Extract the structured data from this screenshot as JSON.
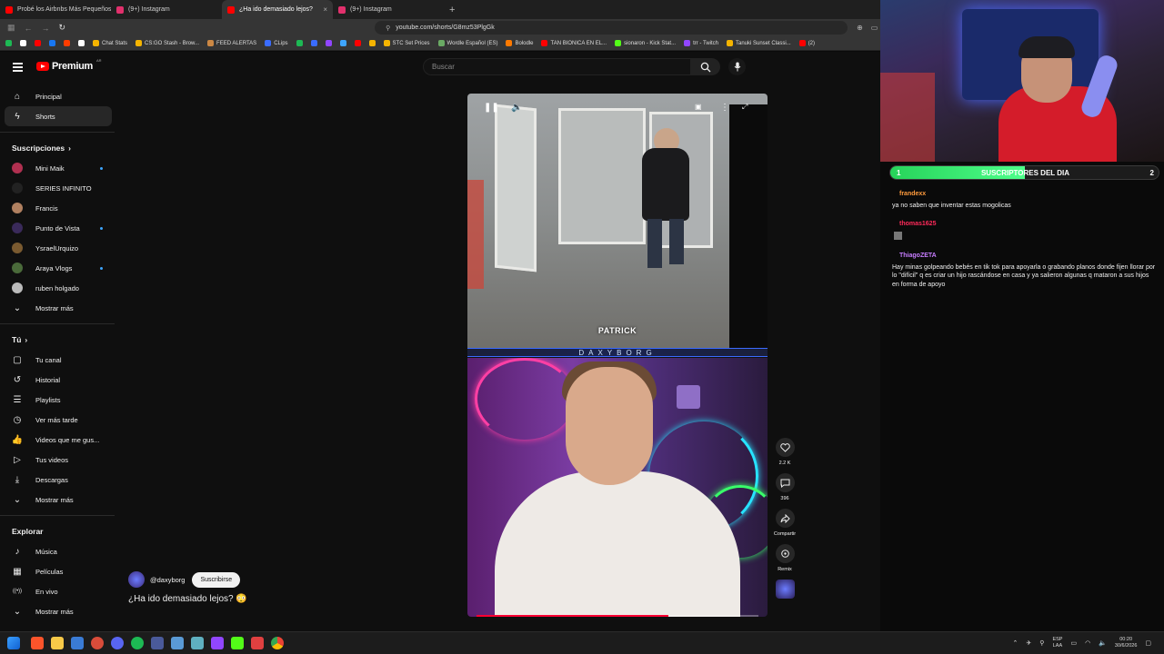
{
  "browser": {
    "tabs": [
      {
        "label": "Probé los Airbnbs Más Pequeños de",
        "color": "#ff0000",
        "active": false
      },
      {
        "label": "(9+) Instagram",
        "color": "#e1306c",
        "active": false
      },
      {
        "label": "¿Ha ido demasiado lejos?",
        "color": "#ff0000",
        "active": true
      },
      {
        "label": "(9+) Instagram",
        "color": "#e1306c",
        "active": false
      }
    ],
    "url": "youtube.com/shorts/G8mz53PlgGk",
    "bookmarks": [
      {
        "label": "",
        "color": "#1db954"
      },
      {
        "label": "",
        "color": "#ffffff"
      },
      {
        "label": "",
        "color": "#ff0000"
      },
      {
        "label": "",
        "color": "#1877f2"
      },
      {
        "label": "",
        "color": "#ff3d00"
      },
      {
        "label": "",
        "color": "#ffffff"
      },
      {
        "label": "Chat Stats",
        "color": "#f5b400"
      },
      {
        "label": "CS:GO Stash - Brow...",
        "color": "#f5b400"
      },
      {
        "label": "FEED ALERTAS",
        "color": "#cc8844"
      },
      {
        "label": "CLips",
        "color": "#3a6cff"
      },
      {
        "label": "",
        "color": "#1db954"
      },
      {
        "label": "",
        "color": "#3a6cff"
      },
      {
        "label": "",
        "color": "#9146ff"
      },
      {
        "label": "",
        "color": "#3ea6ff"
      },
      {
        "label": "",
        "color": "#ff0000"
      },
      {
        "label": "",
        "color": "#f5b400"
      },
      {
        "label": "STC Set Prices",
        "color": "#f5b400"
      },
      {
        "label": "Wordle Español (ES)",
        "color": "#6aaa64"
      },
      {
        "label": "Bolodle",
        "color": "#ff7a00"
      },
      {
        "label": "TAN BIONICA EN EL...",
        "color": "#ff0000"
      },
      {
        "label": "sionaron - Kick Stat...",
        "color": "#53fc18"
      },
      {
        "label": "trr - Twitch",
        "color": "#9146ff"
      },
      {
        "label": "Tanuki Sunset Classi...",
        "color": "#f5b400"
      },
      {
        "label": "(2)",
        "color": "#ff0000"
      }
    ]
  },
  "youtube": {
    "logo_text": "Premium",
    "logo_region": "AR",
    "search_placeholder": "Buscar",
    "sidebar": {
      "top": [
        {
          "label": "Principal",
          "icon": "home-icon",
          "selected": false
        },
        {
          "label": "Shorts",
          "icon": "shorts-icon",
          "selected": true
        }
      ],
      "subs_header": "Suscripciones",
      "subs": [
        {
          "label": "Mini Maik",
          "color": "#b03050",
          "dot": true
        },
        {
          "label": "SERIES INFINITO",
          "color": "#222222",
          "dot": false
        },
        {
          "label": "Francis",
          "color": "#b08060",
          "dot": false
        },
        {
          "label": "Punto de Vista",
          "color": "#3a2a5a",
          "dot": true
        },
        {
          "label": "YsraelUrquizo",
          "color": "#7a5a30",
          "dot": false
        },
        {
          "label": "Araya Vlogs",
          "color": "#4a6a3a",
          "dot": true
        },
        {
          "label": "ruben holgado",
          "color": "#bbbbbb",
          "dot": false
        }
      ],
      "subs_more": "Mostrar más",
      "you_header": "Tú",
      "you": [
        {
          "label": "Tu canal",
          "icon": "channel-icon"
        },
        {
          "label": "Historial",
          "icon": "history-icon"
        },
        {
          "label": "Playlists",
          "icon": "playlist-icon"
        },
        {
          "label": "Ver más tarde",
          "icon": "clock-icon"
        },
        {
          "label": "Videos que me gus...",
          "icon": "like-icon"
        },
        {
          "label": "Tus videos",
          "icon": "video-icon"
        },
        {
          "label": "Descargas",
          "icon": "download-icon"
        }
      ],
      "you_more": "Mostrar más",
      "explore_header": "Explorar",
      "explore": [
        {
          "label": "Música",
          "icon": "music-icon"
        },
        {
          "label": "Películas",
          "icon": "film-icon"
        },
        {
          "label": "En vivo",
          "icon": "live-icon"
        }
      ],
      "explore_more": "Mostrar más"
    },
    "short": {
      "overlay_name": "PATRICK",
      "brand": "DAXYBORG",
      "progress": 0.68,
      "likes": "2.2 K",
      "comments": "396",
      "share_label": "Compartir",
      "remix_label": "Remix",
      "channel": "@daxyborg",
      "subscribe_label": "Suscribirse",
      "title": "¿Ha ido demasiado lejos?",
      "title_emoji": "😳"
    }
  },
  "stream": {
    "subs_title": "SUSCRIPTORES DEL DIA",
    "subs_left": "1",
    "subs_right": "2",
    "subs_progress": 0.5,
    "chat": [
      {
        "user": "frandexx",
        "color": "#ff9b3d",
        "text": "ya no saben que inventar estas mogolicas"
      },
      {
        "user": "thomas1625",
        "color": "#ff2a5a",
        "text": ""
      },
      {
        "user": "ThiagoZETA",
        "color": "#c77dff",
        "text": "Hay minas golpeando bebés en tik tok para apoyarla o grabando planos donde fijen llorar por lo \"difícil\" q es criar un hijo rascándose en casa y ya salieron algunas q mataron a sus hijos en forma de apoyo"
      }
    ]
  },
  "taskbar": {
    "lang_top": "ESP",
    "lang_bottom": "LAA",
    "time": "00:20",
    "date": "30/6/2026"
  }
}
